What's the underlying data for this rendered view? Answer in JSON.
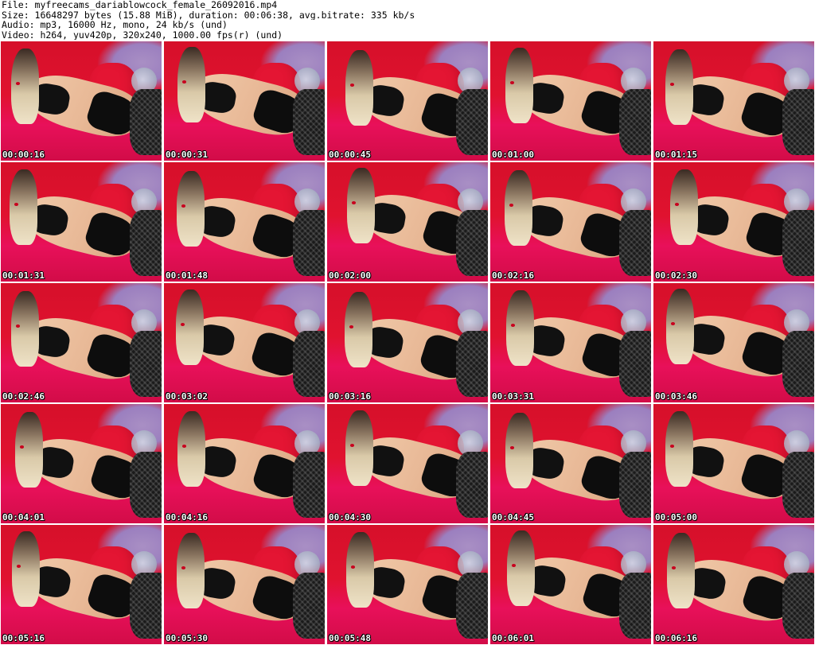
{
  "header": {
    "file_line": "File: myfreecams_dariablowcock_female_26092016.mp4",
    "size_line": "Size: 16648297 bytes (15.88 MiB), duration: 00:06:38, avg.bitrate: 335 kb/s",
    "audio_line": "Audio: mp3, 16000 Hz, mono, 24 kb/s (und)",
    "video_line": "Video: h264, yuv420p, 320x240, 1000.00 fps(r) (und)"
  },
  "colors": {
    "background": "#ffffff",
    "header_text": "#000000",
    "timestamp_text": "#ffffff",
    "timestamp_outline": "#000000",
    "sofa_red": "#d6102a",
    "wall_purple": "#9b7fbf"
  },
  "thumbnails": [
    {
      "timestamp": "00:00:16"
    },
    {
      "timestamp": "00:00:31"
    },
    {
      "timestamp": "00:00:45"
    },
    {
      "timestamp": "00:01:00"
    },
    {
      "timestamp": "00:01:15"
    },
    {
      "timestamp": "00:01:31"
    },
    {
      "timestamp": "00:01:48"
    },
    {
      "timestamp": "00:02:00"
    },
    {
      "timestamp": "00:02:16"
    },
    {
      "timestamp": "00:02:30"
    },
    {
      "timestamp": "00:02:46"
    },
    {
      "timestamp": "00:03:02"
    },
    {
      "timestamp": "00:03:16"
    },
    {
      "timestamp": "00:03:31"
    },
    {
      "timestamp": "00:03:46"
    },
    {
      "timestamp": "00:04:01"
    },
    {
      "timestamp": "00:04:16"
    },
    {
      "timestamp": "00:04:30"
    },
    {
      "timestamp": "00:04:45"
    },
    {
      "timestamp": "00:05:00"
    },
    {
      "timestamp": "00:05:16"
    },
    {
      "timestamp": "00:05:30"
    },
    {
      "timestamp": "00:05:48"
    },
    {
      "timestamp": "00:06:01"
    },
    {
      "timestamp": "00:06:16"
    }
  ]
}
